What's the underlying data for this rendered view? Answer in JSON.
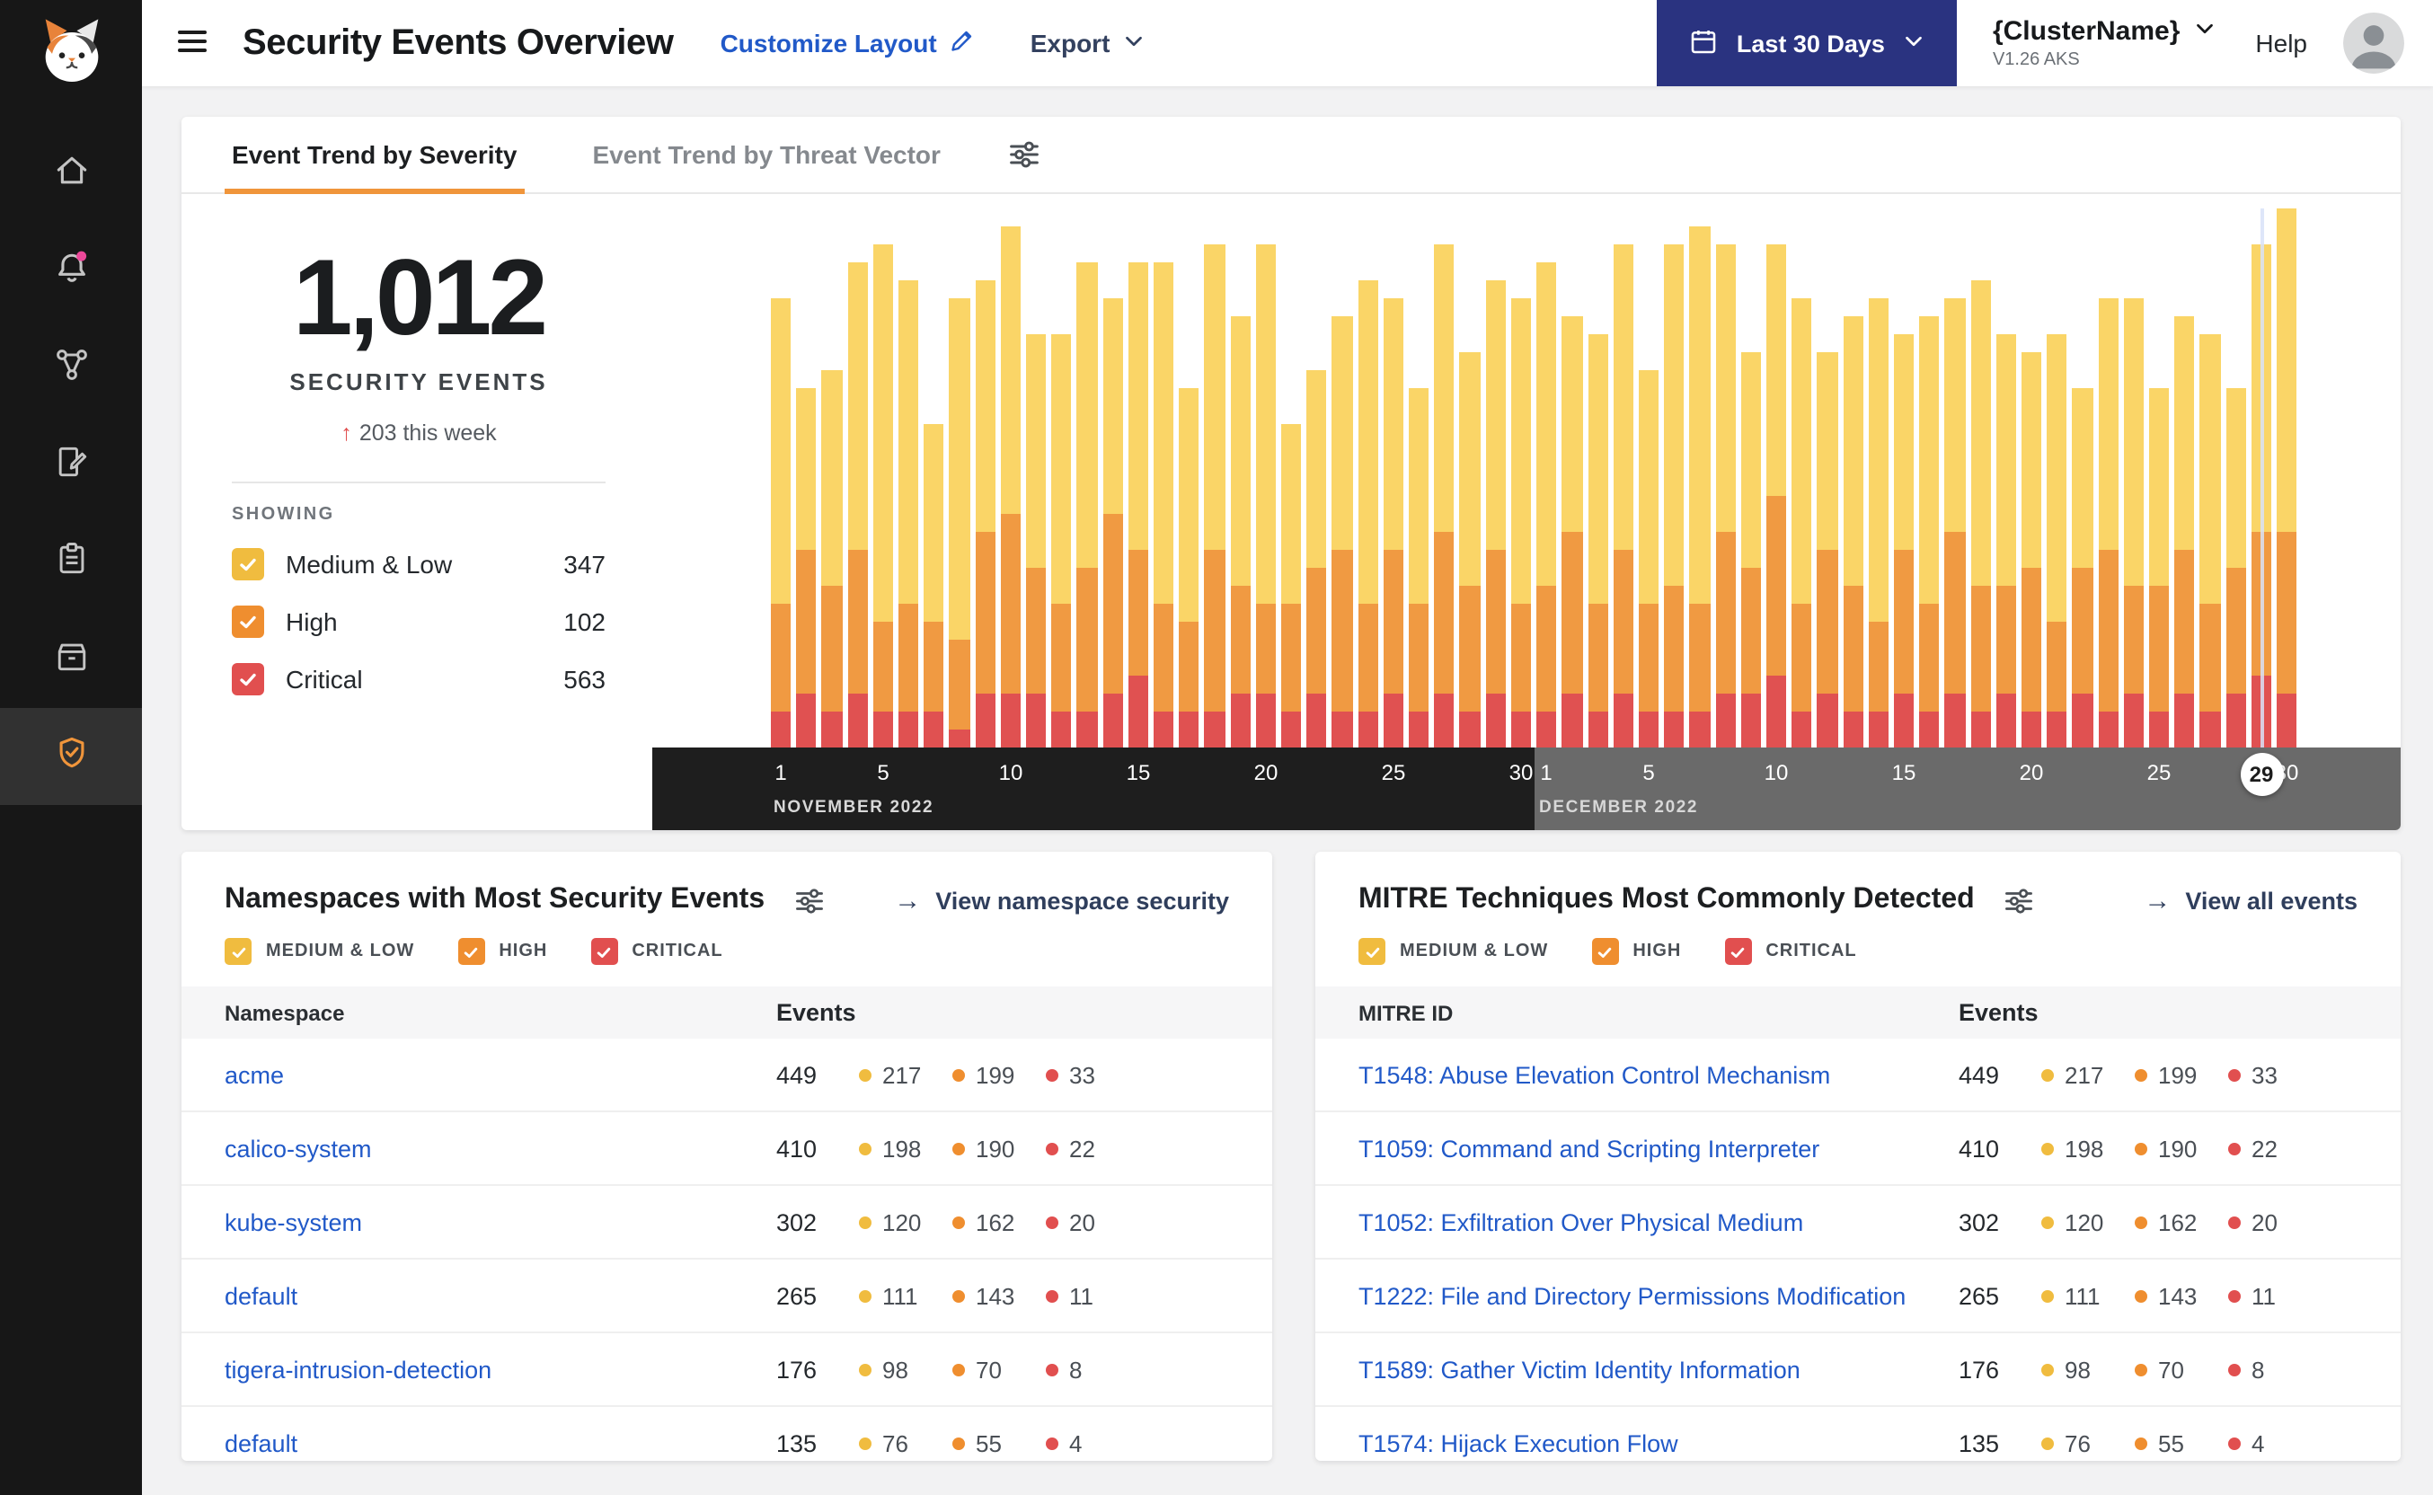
{
  "icons": {
    "arrow_right": "→",
    "arrow_up": "↑"
  },
  "colors": {
    "accent_orange": "#F0953B",
    "link_blue": "#2159C8",
    "action_link": "#2F3E5C",
    "nav_button_blue": "#2A3380",
    "notification_pink": "#EC4899",
    "axis_november_bg": "#1E1E1E",
    "axis_december_bg": "#6A6A6A",
    "severity": {
      "medium_low": {
        "control": "#F0BC3F",
        "bar": "#FAD567"
      },
      "high": {
        "control": "#EF8E2F",
        "bar": "#F09A42"
      },
      "critical": {
        "control": "#E14F4F",
        "bar": "#E05151"
      }
    }
  },
  "header": {
    "title": "Security Events Overview",
    "customize_layout": "Customize Layout",
    "export": "Export",
    "date_range": "Last 30 Days",
    "cluster_name": "{ClusterName}",
    "cluster_version": "V1.26 AKS",
    "help": "Help"
  },
  "trend_card": {
    "tabs": [
      {
        "label": "Event Trend by Severity",
        "active": true
      },
      {
        "label": "Event Trend by Threat Vector",
        "active": false
      }
    ],
    "summary": {
      "total": "1,012",
      "total_label": "SECURITY EVENTS",
      "delta": "203 this week",
      "showing_label": "SHOWING",
      "legend": [
        {
          "label": "Medium & Low",
          "count": "347",
          "severity": "medium_low"
        },
        {
          "label": "High",
          "count": "102",
          "severity": "high"
        },
        {
          "label": "Critical",
          "count": "563",
          "severity": "critical"
        }
      ]
    },
    "chart_data": {
      "type": "bar",
      "stacked": true,
      "bar_format": [
        "medium_low",
        "high",
        "critical"
      ],
      "months": [
        {
          "label": "NOVEMBER 2022",
          "days": 30,
          "ticks": [
            1,
            5,
            10,
            15,
            20,
            25,
            30
          ]
        },
        {
          "label": "DECEMBER 2022",
          "days": 30,
          "ticks": [
            1,
            5,
            10,
            15,
            20,
            25,
            30
          ]
        }
      ],
      "selected_day": {
        "month_index": 1,
        "day": 29
      },
      "bars": [
        [
          17,
          6,
          2
        ],
        [
          9,
          8,
          3
        ],
        [
          12,
          7,
          2
        ],
        [
          16,
          8,
          3
        ],
        [
          21,
          5,
          2
        ],
        [
          18,
          6,
          2
        ],
        [
          11,
          5,
          2
        ],
        [
          19,
          5,
          1
        ],
        [
          14,
          9,
          3
        ],
        [
          16,
          10,
          3
        ],
        [
          13,
          7,
          3
        ],
        [
          15,
          6,
          2
        ],
        [
          17,
          8,
          2
        ],
        [
          12,
          10,
          3
        ],
        [
          16,
          7,
          4
        ],
        [
          19,
          6,
          2
        ],
        [
          13,
          5,
          2
        ],
        [
          17,
          9,
          2
        ],
        [
          15,
          6,
          3
        ],
        [
          20,
          5,
          3
        ],
        [
          10,
          6,
          2
        ],
        [
          11,
          7,
          3
        ],
        [
          13,
          9,
          2
        ],
        [
          18,
          6,
          2
        ],
        [
          14,
          8,
          3
        ],
        [
          12,
          6,
          2
        ],
        [
          16,
          9,
          3
        ],
        [
          13,
          7,
          2
        ],
        [
          15,
          8,
          3
        ],
        [
          17,
          6,
          2
        ],
        [
          18,
          7,
          2
        ],
        [
          12,
          9,
          3
        ],
        [
          15,
          6,
          2
        ],
        [
          17,
          8,
          3
        ],
        [
          13,
          6,
          2
        ],
        [
          19,
          7,
          2
        ],
        [
          21,
          6,
          2
        ],
        [
          16,
          9,
          3
        ],
        [
          12,
          7,
          3
        ],
        [
          14,
          10,
          4
        ],
        [
          17,
          6,
          2
        ],
        [
          11,
          8,
          3
        ],
        [
          15,
          7,
          2
        ],
        [
          18,
          5,
          2
        ],
        [
          12,
          8,
          3
        ],
        [
          16,
          6,
          2
        ],
        [
          13,
          9,
          3
        ],
        [
          17,
          7,
          2
        ],
        [
          14,
          6,
          3
        ],
        [
          12,
          8,
          2
        ],
        [
          16,
          5,
          2
        ],
        [
          10,
          7,
          3
        ],
        [
          14,
          9,
          2
        ],
        [
          16,
          6,
          3
        ],
        [
          11,
          7,
          2
        ],
        [
          13,
          8,
          3
        ],
        [
          15,
          6,
          2
        ],
        [
          10,
          7,
          3
        ],
        [
          16,
          8,
          4
        ],
        [
          18,
          9,
          3
        ]
      ]
    }
  },
  "namespace_card": {
    "title": "Namespaces with Most Security Events",
    "action": "View namespace security",
    "legend": [
      {
        "label": "MEDIUM & LOW",
        "severity": "medium_low"
      },
      {
        "label": "HIGH",
        "severity": "high"
      },
      {
        "label": "CRITICAL",
        "severity": "critical"
      }
    ],
    "columns": {
      "name": "Namespace",
      "events": "Events"
    },
    "rows": [
      {
        "name": "acme",
        "total": "449",
        "medium_low": "217",
        "high": "199",
        "critical": "33"
      },
      {
        "name": "calico-system",
        "total": "410",
        "medium_low": "198",
        "high": "190",
        "critical": "22"
      },
      {
        "name": "kube-system",
        "total": "302",
        "medium_low": "120",
        "high": "162",
        "critical": "20"
      },
      {
        "name": "default",
        "total": "265",
        "medium_low": "111",
        "high": "143",
        "critical": "11"
      },
      {
        "name": "tigera-intrusion-detection",
        "total": "176",
        "medium_low": "98",
        "high": "70",
        "critical": "8"
      },
      {
        "name": "default",
        "total": "135",
        "medium_low": "76",
        "high": "55",
        "critical": "4"
      }
    ]
  },
  "mitre_card": {
    "title": "MITRE Techniques Most Commonly Detected",
    "action": "View all events",
    "legend": [
      {
        "label": "MEDIUM & LOW",
        "severity": "medium_low"
      },
      {
        "label": "HIGH",
        "severity": "high"
      },
      {
        "label": "CRITICAL",
        "severity": "critical"
      }
    ],
    "columns": {
      "name": "MITRE ID",
      "events": "Events"
    },
    "rows": [
      {
        "name": "T1548: Abuse Elevation Control Mechanism",
        "total": "449",
        "medium_low": "217",
        "high": "199",
        "critical": "33"
      },
      {
        "name": "T1059: Command and Scripting Interpreter",
        "total": "410",
        "medium_low": "198",
        "high": "190",
        "critical": "22"
      },
      {
        "name": "T1052: Exfiltration Over Physical Medium",
        "total": "302",
        "medium_low": "120",
        "high": "162",
        "critical": "20"
      },
      {
        "name": "T1222: File and Directory Permissions Modification",
        "total": "265",
        "medium_low": "111",
        "high": "143",
        "critical": "11"
      },
      {
        "name": "T1589: Gather Victim Identity Information",
        "total": "176",
        "medium_low": "98",
        "high": "70",
        "critical": "8"
      },
      {
        "name": "T1574: Hijack Execution Flow",
        "total": "135",
        "medium_low": "76",
        "high": "55",
        "critical": "4"
      }
    ]
  }
}
